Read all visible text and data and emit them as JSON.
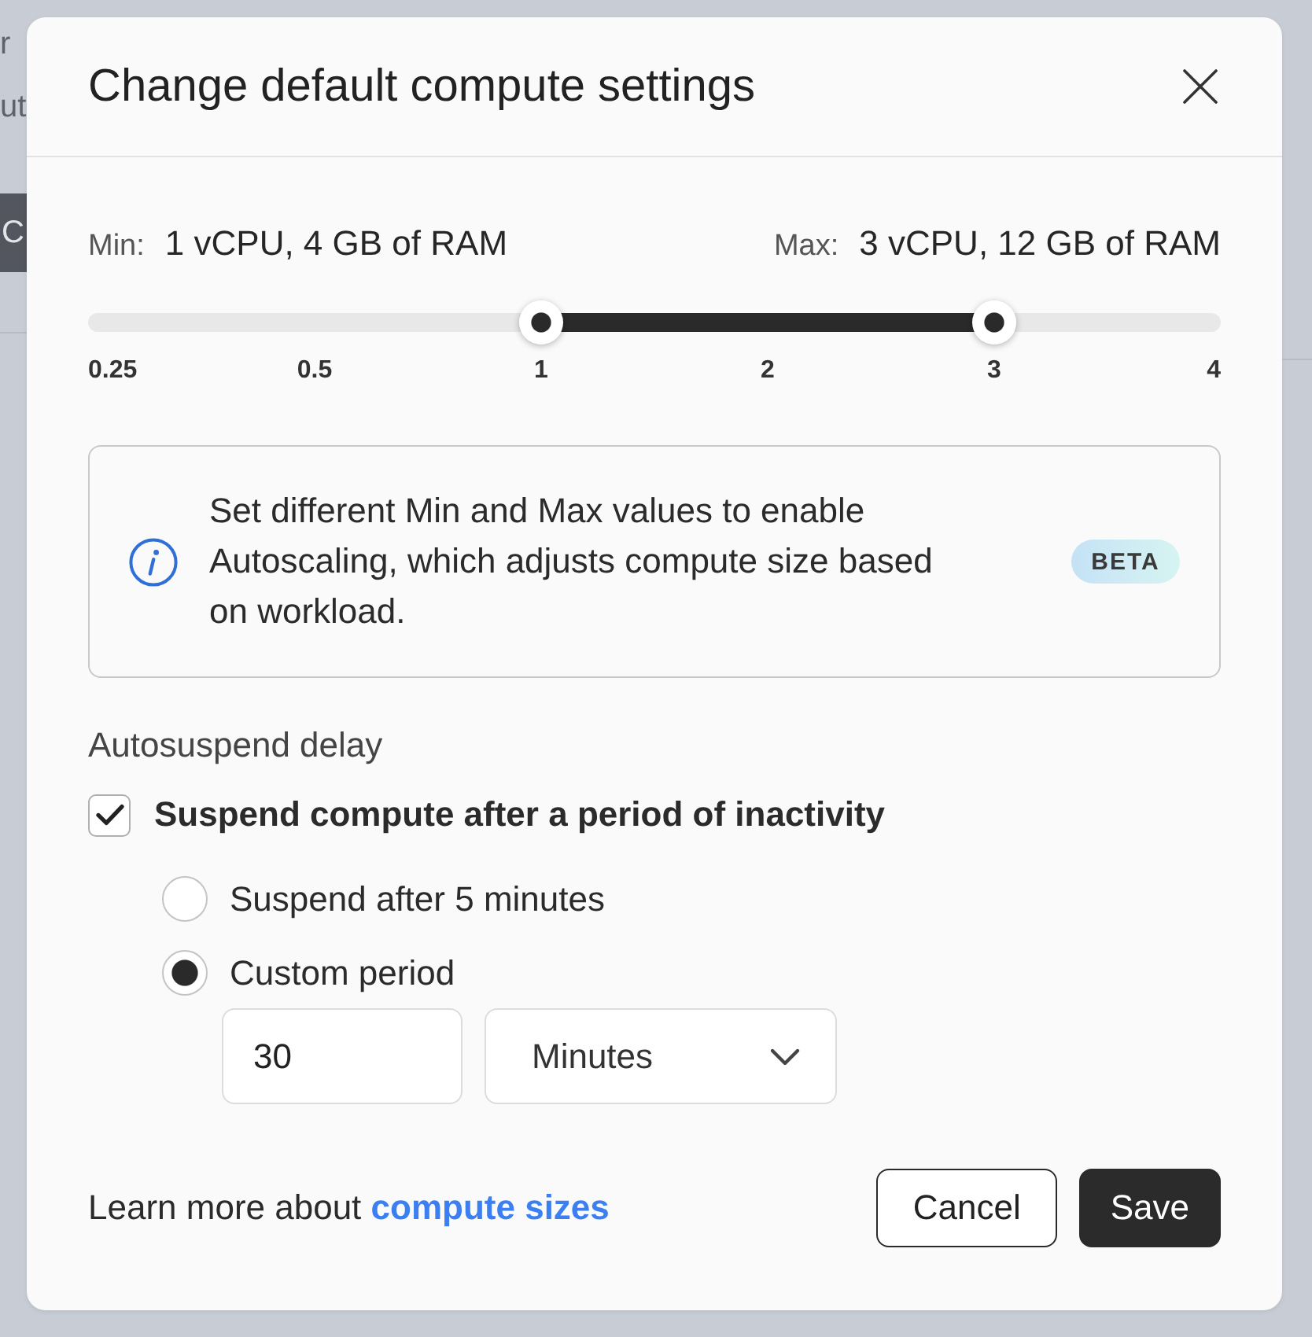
{
  "background_page": {
    "texts": [
      "r",
      "ut"
    ],
    "button": {
      "label": "C"
    }
  },
  "dialog": {
    "title": "Change default compute settings",
    "range": {
      "min_label": "Min:",
      "min_value": "1 vCPU, 4 GB of RAM",
      "max_label": "Max:",
      "max_value": "3 vCPU, 12 GB of RAM"
    },
    "slider": {
      "thumbs": [
        {
          "level": 0.4
        },
        {
          "level": 0.8
        }
      ],
      "ticks": [
        "0.25",
        "0.5",
        "1",
        "2",
        "3",
        "4"
      ]
    },
    "notice": {
      "text": "Set different Min and Max values to enable Autoscaling, which adjusts compute size based on workload.",
      "badge": "BETA"
    },
    "autosuspend": {
      "heading": "Autosuspend delay",
      "checkbox": {
        "label": "Suspend compute after a period of inactivity",
        "checked": true
      },
      "options": [
        {
          "label": "Suspend after 5 minutes",
          "selected": false
        },
        {
          "label": "Custom period",
          "selected": true
        }
      ],
      "period_value": "30",
      "unit": "Minutes"
    },
    "footer": {
      "text": "Learn more about",
      "link": "compute sizes",
      "buttons": [
        {
          "label": "Cancel",
          "kind": "secondary"
        },
        {
          "label": "Save",
          "kind": "primary"
        }
      ]
    }
  }
}
